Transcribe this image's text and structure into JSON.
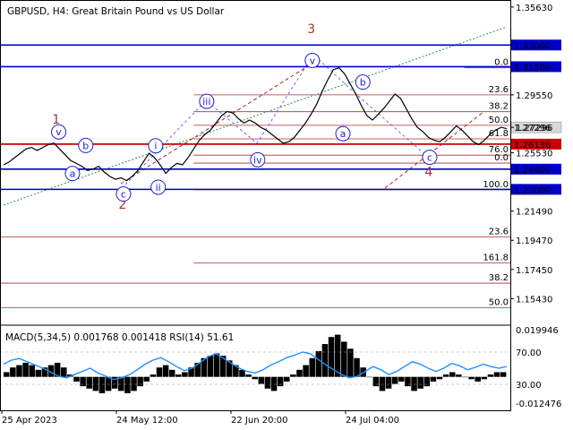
{
  "chart_data": {
    "type": "candlestick",
    "title": "GBPUSD, H4:  Great Britain Pound vs US Dollar",
    "price_axis": {
      "ylim": [
        1.1365,
        1.3612
      ],
      "tick_labels": [
        "1.35630",
        "1.29550",
        "1.27296",
        "1.25530",
        "1.21490",
        "1.19470",
        "1.17450",
        "1.15430"
      ],
      "tick_values": [
        1.3563,
        1.2955,
        1.27296,
        1.2553,
        1.2149,
        1.1947,
        1.1745,
        1.1543
      ]
    },
    "time_axis": {
      "tick_labels": [
        "25 Apr 2023",
        "24 May 12:00",
        "22 Jun 20:00",
        "24 Jul 04:00"
      ]
    },
    "current_price": {
      "value": 1.27296,
      "label": "1.27296"
    },
    "price_series": [
      1.247,
      1.249,
      1.252,
      1.255,
      1.258,
      1.259,
      1.257,
      1.259,
      1.261,
      1.262,
      1.258,
      1.254,
      1.25,
      1.248,
      1.246,
      1.243,
      1.244,
      1.246,
      1.242,
      1.239,
      1.237,
      1.238,
      1.236,
      1.239,
      1.243,
      1.249,
      1.255,
      1.252,
      1.247,
      1.241,
      1.245,
      1.248,
      1.247,
      1.252,
      1.258,
      1.264,
      1.268,
      1.271,
      1.276,
      1.281,
      1.284,
      1.283,
      1.279,
      1.276,
      1.278,
      1.276,
      1.273,
      1.271,
      1.268,
      1.265,
      1.262,
      1.263,
      1.266,
      1.271,
      1.276,
      1.282,
      1.289,
      1.298,
      1.306,
      1.313,
      1.3142,
      1.31,
      1.303,
      1.296,
      1.288,
      1.281,
      1.278,
      1.282,
      1.286,
      1.291,
      1.296,
      1.293,
      1.286,
      1.279,
      1.273,
      1.27,
      1.266,
      1.264,
      1.263,
      1.266,
      1.27,
      1.274,
      1.271,
      1.267,
      1.263,
      1.261,
      1.264,
      1.268,
      1.271,
      1.273,
      1.272
    ],
    "horizontal_lines": [
      {
        "name": "level-1.33000",
        "value": 1.33,
        "label": "1.33000",
        "color": "#0000cc",
        "width": 1.6
      },
      {
        "name": "level-1.31500",
        "value": 1.315,
        "label": "1.31500",
        "color": "#0000cc",
        "width": 1.6
      },
      {
        "name": "level-1.26136",
        "value": 1.26136,
        "label": "1.26136",
        "color": "#cc0000",
        "width": 1.8
      },
      {
        "name": "level-1.24400",
        "value": 1.244,
        "label": "1.24400",
        "color": "#0000cc",
        "width": 1.6
      },
      {
        "name": "level-1.23000",
        "value": 1.23,
        "label": "1.23000",
        "color": "#0000cc",
        "width": 1.6
      }
    ],
    "fib_levels": [
      {
        "label": "0.0",
        "value": 1.3142,
        "x_from": 0.72
      },
      {
        "label": "23.6",
        "value": 1.2955,
        "x_from": 0.19
      },
      {
        "label": "38.2",
        "value": 1.2838,
        "x_from": 0.19
      },
      {
        "label": "50.0",
        "value": 1.2744,
        "x_from": 0.19
      },
      {
        "label": "61.8",
        "value": 1.265,
        "x_from": 0.19
      },
      {
        "label": "76.0",
        "value": 1.2537,
        "x_from": 0.19
      },
      {
        "label": "0.0",
        "value": 1.2482,
        "x_from": 0.19
      },
      {
        "label": "100.0",
        "value": 1.2297,
        "x_from": 0.19
      },
      {
        "label": "23.6",
        "value": 1.197,
        "x_from": 0.0
      },
      {
        "label": "161.8",
        "value": 1.179,
        "x_from": 0.19
      },
      {
        "label": "38.2",
        "value": 1.165,
        "x_from": 0.0
      },
      {
        "label": "50.0",
        "value": 1.148,
        "x_from": 0.0
      }
    ],
    "wave_labels_major": [
      {
        "text": "1",
        "x": 0.11,
        "price": 1.2755
      },
      {
        "text": "2",
        "x": 0.24,
        "price": 1.2167
      },
      {
        "text": "3",
        "x": 0.61,
        "price": 1.3382
      },
      {
        "text": "4",
        "x": 0.84,
        "price": 1.2393
      }
    ],
    "wave_labels_minor": [
      {
        "text": "v",
        "x": 0.115,
        "price": 1.2698
      },
      {
        "text": "a",
        "x": 0.142,
        "price": 1.241
      },
      {
        "text": "b",
        "x": 0.168,
        "price": 1.2604
      },
      {
        "text": "c",
        "x": 0.242,
        "price": 1.2268
      },
      {
        "text": "i",
        "x": 0.305,
        "price": 1.2602
      },
      {
        "text": "ii",
        "x": 0.31,
        "price": 1.2315
      },
      {
        "text": "iii",
        "x": 0.405,
        "price": 1.291
      },
      {
        "text": "iv",
        "x": 0.505,
        "price": 1.2505
      },
      {
        "text": "v",
        "x": 0.612,
        "price": 1.3193
      },
      {
        "text": "a",
        "x": 0.672,
        "price": 1.2686
      },
      {
        "text": "b",
        "x": 0.711,
        "price": 1.3043
      },
      {
        "text": "c",
        "x": 0.842,
        "price": 1.2522
      }
    ],
    "macd": {
      "label": "MACD(5,34,5) 0.001768 0.001418 RSI(14) 51.61",
      "ylim": [
        -0.0135,
        0.0209
      ],
      "tick_labels": [
        "0.019946",
        "70.00",
        "30.00",
        "-0.012476"
      ],
      "rsi_levels": [
        70,
        30
      ],
      "histogram": [
        0.002,
        0.004,
        0.005,
        0.006,
        0.005,
        0.003,
        0.004,
        0.005,
        0.006,
        0.004,
        0.001,
        -0.002,
        -0.004,
        -0.005,
        -0.006,
        -0.007,
        -0.006,
        -0.005,
        -0.006,
        -0.007,
        -0.006,
        -0.004,
        -0.002,
        0.001,
        0.004,
        0.005,
        0.003,
        0.001,
        0.002,
        0.004,
        0.006,
        0.008,
        0.009,
        0.01,
        0.009,
        0.007,
        0.005,
        0.003,
        0.001,
        -0.001,
        -0.003,
        -0.005,
        -0.006,
        -0.004,
        -0.002,
        0.001,
        0.003,
        0.005,
        0.008,
        0.011,
        0.014,
        0.017,
        0.018,
        0.015,
        0.012,
        0.008,
        0.004,
        0.0,
        -0.004,
        -0.006,
        -0.005,
        -0.003,
        -0.002,
        -0.004,
        -0.006,
        -0.005,
        -0.004,
        -0.002,
        -0.001,
        0.001,
        0.002,
        0.001,
        0.0,
        -0.001,
        -0.002,
        -0.001,
        0.001,
        0.002,
        0.002
      ],
      "rsi": [
        55,
        60,
        62,
        58,
        54,
        50,
        45,
        40,
        38,
        42,
        46,
        50,
        44,
        40,
        36,
        38,
        42,
        48,
        55,
        60,
        63,
        58,
        52,
        47,
        50,
        57,
        64,
        68,
        62,
        56,
        50,
        46,
        44,
        48,
        54,
        58,
        63,
        66,
        70,
        68,
        61,
        54,
        48,
        42,
        38,
        40,
        46,
        52,
        48,
        42,
        46,
        52,
        58,
        55,
        50,
        46,
        50,
        56,
        53,
        48,
        51,
        55,
        52,
        50,
        52
      ]
    }
  }
}
